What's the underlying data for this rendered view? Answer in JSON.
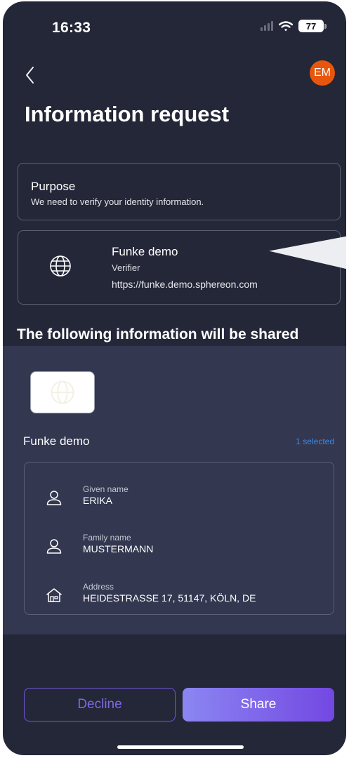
{
  "status_bar": {
    "time": "16:33",
    "battery": "77"
  },
  "header": {
    "avatar_initials": "EM",
    "title": "Information request"
  },
  "purpose": {
    "title": "Purpose",
    "text": "We need to verify your identity information."
  },
  "verifier": {
    "name": "Funke demo",
    "role": "Verifier",
    "url": "https://funke.demo.sphereon.com"
  },
  "shared": {
    "heading": "The following information will be shared",
    "credential_name": "Funke demo",
    "selected_label": "1 selected",
    "claims": [
      {
        "label": "Given name",
        "value": "ERIKA",
        "icon": "person-icon"
      },
      {
        "label": "Family name",
        "value": "MUSTERMANN",
        "icon": "person-icon"
      },
      {
        "label": "Address",
        "value": "HEIDESTRASSE 17, 51147, KÖLN, DE",
        "icon": "house-icon"
      }
    ]
  },
  "actions": {
    "decline_label": "Decline",
    "share_label": "Share"
  },
  "colors": {
    "background": "#242738",
    "panel": "#333750",
    "accent": "#7348e2",
    "avatar": "#e8560d",
    "link": "#3a8be8"
  }
}
